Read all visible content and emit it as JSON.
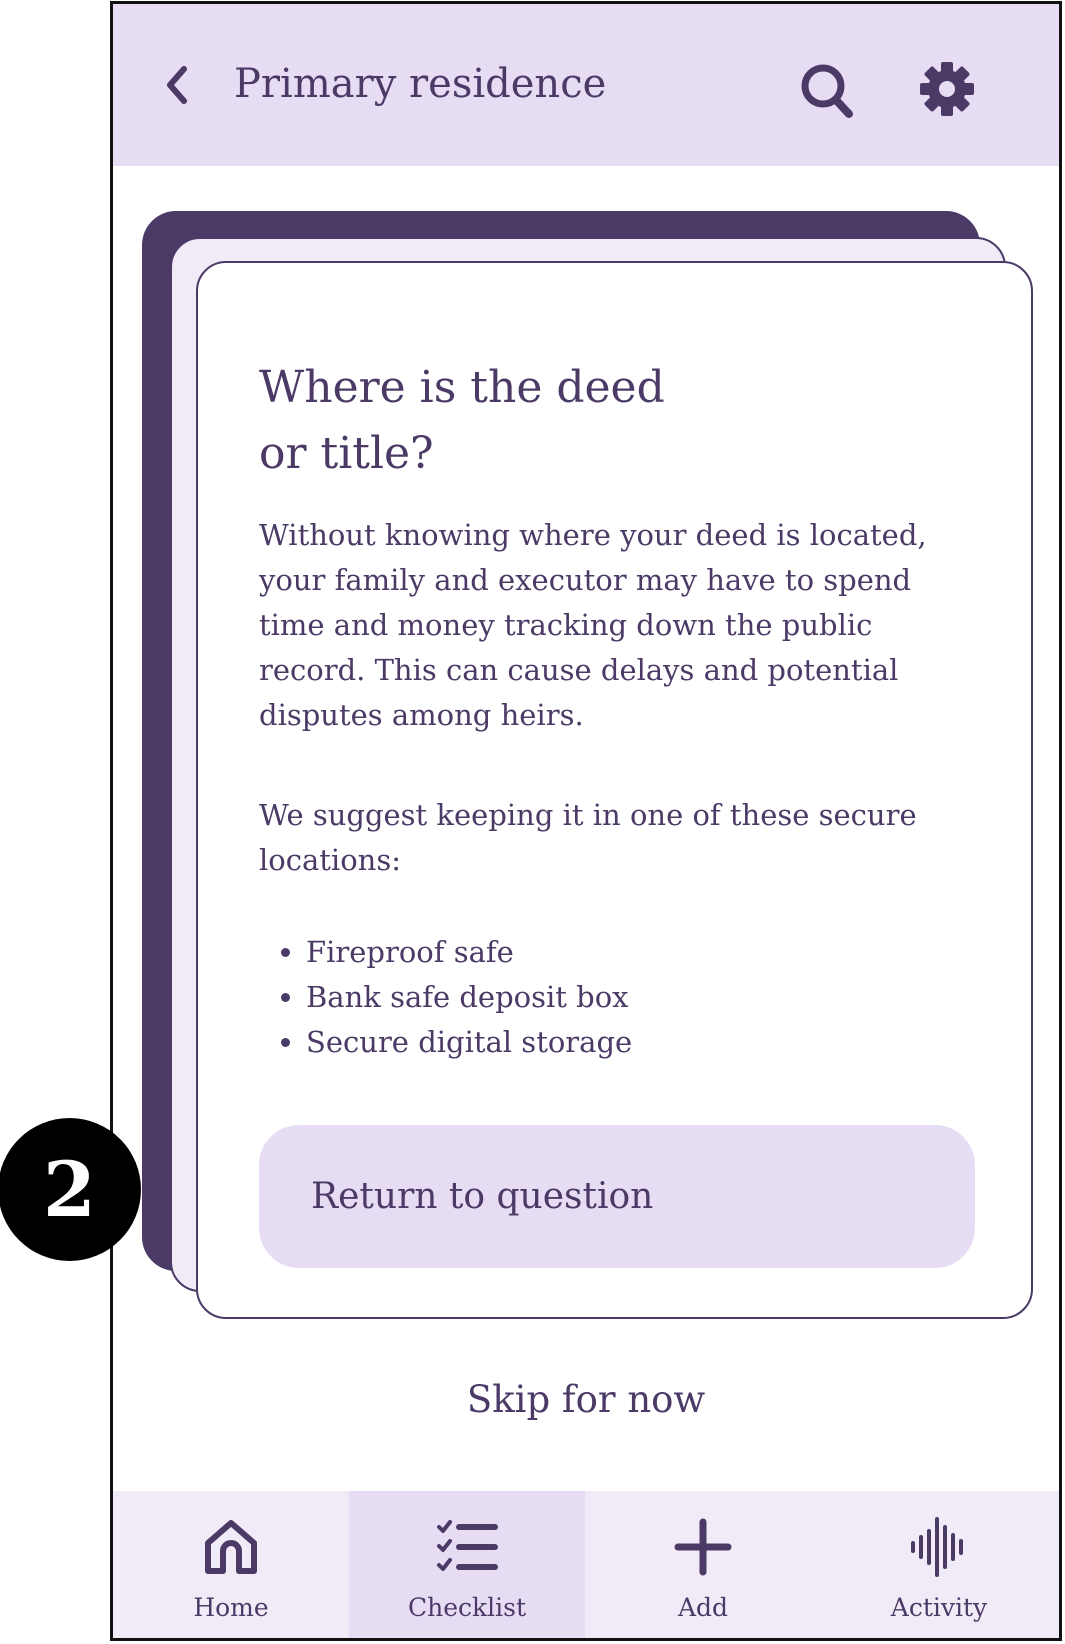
{
  "header": {
    "title": "Primary residence",
    "back_icon": "chevron-left-icon",
    "search_icon": "search-icon",
    "settings_icon": "gear-icon"
  },
  "card": {
    "title_line1": "Where is the deed",
    "title_line2": "or title?",
    "paragraph1": "Without knowing where your deed is located, your family and executor may have to spend time and money tracking down the public record. This can cause delays and potential disputes among heirs.",
    "paragraph2": "We suggest keeping it in one of these secure locations:",
    "locations": [
      "Fireproof safe",
      "Bank safe deposit box",
      "Secure digital storage"
    ],
    "button_label": "Return to question"
  },
  "skip_label": "Skip for now",
  "nav": {
    "items": [
      {
        "label": "Home",
        "icon": "home-icon",
        "active": false
      },
      {
        "label": "Checklist",
        "icon": "checklist-icon",
        "active": true
      },
      {
        "label": "Add",
        "icon": "plus-icon",
        "active": false
      },
      {
        "label": "Activity",
        "icon": "waveform-icon",
        "active": false
      }
    ]
  },
  "step_badge": "2",
  "colors": {
    "primary": "#4b3a66",
    "header_bg": "#e6ddf5",
    "nav_bg": "#f1ebf8",
    "active_nav_bg": "#e6ddf5"
  }
}
